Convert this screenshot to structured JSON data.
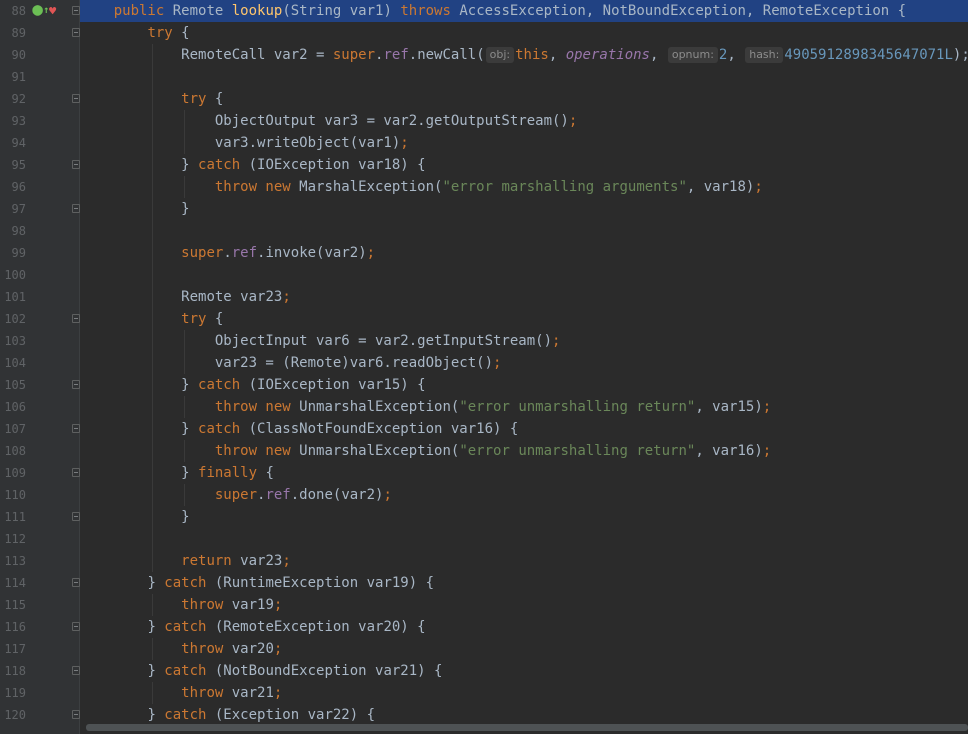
{
  "editor": {
    "lines": [
      {
        "num": "88",
        "hl": true,
        "guides": 0,
        "tokens": [
          {
            "t": "    "
          },
          {
            "t": "public ",
            "c": "kw"
          },
          {
            "t": "Remote "
          },
          {
            "t": "lookup",
            "c": "fn"
          },
          {
            "t": "(String var1) "
          },
          {
            "t": "throws ",
            "c": "kw"
          },
          {
            "t": "AccessException, NotBoundException, RemoteException {"
          }
        ]
      },
      {
        "num": "89",
        "guides": 0,
        "tokens": [
          {
            "t": "        "
          },
          {
            "t": "try ",
            "c": "kw"
          },
          {
            "t": "{"
          }
        ]
      },
      {
        "num": "90",
        "guides": 1,
        "tokens": [
          {
            "t": "            "
          },
          {
            "t": "RemoteCall var2 = "
          },
          {
            "t": "super",
            "c": "kw"
          },
          {
            "t": "."
          },
          {
            "t": "ref",
            "c": "field"
          },
          {
            "t": ".newCall("
          },
          {
            "t": "obj:",
            "c": "hint"
          },
          {
            "t": "this",
            "c": "kw"
          },
          {
            "t": ", "
          },
          {
            "t": "operations",
            "c": "ital"
          },
          {
            "t": ", "
          },
          {
            "t": "opnum:",
            "c": "hint"
          },
          {
            "t": "2",
            "c": "num"
          },
          {
            "t": ", "
          },
          {
            "t": "hash:",
            "c": "hint"
          },
          {
            "t": "4905912898345647071L",
            "c": "num"
          },
          {
            "t": ");"
          }
        ]
      },
      {
        "num": "91",
        "guides": 1,
        "tokens": []
      },
      {
        "num": "92",
        "guides": 1,
        "tokens": [
          {
            "t": "            "
          },
          {
            "t": "try ",
            "c": "kw"
          },
          {
            "t": "{"
          }
        ]
      },
      {
        "num": "93",
        "guides": 2,
        "tokens": [
          {
            "t": "                "
          },
          {
            "t": "ObjectOutput var3 = var2.getOutputStream()"
          },
          {
            "t": ";",
            "c": "kw"
          }
        ]
      },
      {
        "num": "94",
        "guides": 2,
        "tokens": [
          {
            "t": "                "
          },
          {
            "t": "var3.writeObject(var1)"
          },
          {
            "t": ";",
            "c": "kw"
          }
        ]
      },
      {
        "num": "95",
        "guides": 1,
        "tokens": [
          {
            "t": "            "
          },
          {
            "t": "} "
          },
          {
            "t": "catch ",
            "c": "kw"
          },
          {
            "t": "(IOException var18) {"
          }
        ]
      },
      {
        "num": "96",
        "guides": 2,
        "tokens": [
          {
            "t": "                "
          },
          {
            "t": "throw new ",
            "c": "kw"
          },
          {
            "t": "MarshalException("
          },
          {
            "t": "\"error marshalling arguments\"",
            "c": "str"
          },
          {
            "t": ", var18)"
          },
          {
            "t": ";",
            "c": "kw"
          }
        ]
      },
      {
        "num": "97",
        "guides": 1,
        "tokens": [
          {
            "t": "            "
          },
          {
            "t": "}"
          }
        ]
      },
      {
        "num": "98",
        "guides": 1,
        "tokens": []
      },
      {
        "num": "99",
        "guides": 1,
        "tokens": [
          {
            "t": "            "
          },
          {
            "t": "super",
            "c": "kw"
          },
          {
            "t": "."
          },
          {
            "t": "ref",
            "c": "field"
          },
          {
            "t": ".invoke(var2)"
          },
          {
            "t": ";",
            "c": "kw"
          }
        ]
      },
      {
        "num": "100",
        "guides": 1,
        "tokens": []
      },
      {
        "num": "101",
        "guides": 1,
        "tokens": [
          {
            "t": "            "
          },
          {
            "t": "Remote var23"
          },
          {
            "t": ";",
            "c": "kw"
          }
        ]
      },
      {
        "num": "102",
        "guides": 1,
        "tokens": [
          {
            "t": "            "
          },
          {
            "t": "try ",
            "c": "kw"
          },
          {
            "t": "{"
          }
        ]
      },
      {
        "num": "103",
        "guides": 2,
        "tokens": [
          {
            "t": "                "
          },
          {
            "t": "ObjectInput var6 = var2.getInputStream()"
          },
          {
            "t": ";",
            "c": "kw"
          }
        ]
      },
      {
        "num": "104",
        "guides": 2,
        "tokens": [
          {
            "t": "                "
          },
          {
            "t": "var23 = (Remote)var6.readObject()"
          },
          {
            "t": ";",
            "c": "kw"
          }
        ]
      },
      {
        "num": "105",
        "guides": 1,
        "tokens": [
          {
            "t": "            "
          },
          {
            "t": "} "
          },
          {
            "t": "catch ",
            "c": "kw"
          },
          {
            "t": "(IOException var15) {"
          }
        ]
      },
      {
        "num": "106",
        "guides": 2,
        "tokens": [
          {
            "t": "                "
          },
          {
            "t": "throw new ",
            "c": "kw"
          },
          {
            "t": "UnmarshalException("
          },
          {
            "t": "\"error unmarshalling return\"",
            "c": "str"
          },
          {
            "t": ", var15)"
          },
          {
            "t": ";",
            "c": "kw"
          }
        ]
      },
      {
        "num": "107",
        "guides": 1,
        "tokens": [
          {
            "t": "            "
          },
          {
            "t": "} "
          },
          {
            "t": "catch ",
            "c": "kw"
          },
          {
            "t": "(ClassNotFoundException var16) {"
          }
        ]
      },
      {
        "num": "108",
        "guides": 2,
        "tokens": [
          {
            "t": "                "
          },
          {
            "t": "throw new ",
            "c": "kw"
          },
          {
            "t": "UnmarshalException("
          },
          {
            "t": "\"error unmarshalling return\"",
            "c": "str"
          },
          {
            "t": ", var16)"
          },
          {
            "t": ";",
            "c": "kw"
          }
        ]
      },
      {
        "num": "109",
        "guides": 1,
        "tokens": [
          {
            "t": "            "
          },
          {
            "t": "} "
          },
          {
            "t": "finally ",
            "c": "kw"
          },
          {
            "t": "{"
          }
        ]
      },
      {
        "num": "110",
        "guides": 2,
        "tokens": [
          {
            "t": "                "
          },
          {
            "t": "super",
            "c": "kw"
          },
          {
            "t": "."
          },
          {
            "t": "ref",
            "c": "field"
          },
          {
            "t": ".done(var2)"
          },
          {
            "t": ";",
            "c": "kw"
          }
        ]
      },
      {
        "num": "111",
        "guides": 1,
        "tokens": [
          {
            "t": "            "
          },
          {
            "t": "}"
          }
        ]
      },
      {
        "num": "112",
        "guides": 1,
        "tokens": []
      },
      {
        "num": "113",
        "guides": 1,
        "tokens": [
          {
            "t": "            "
          },
          {
            "t": "return ",
            "c": "kw"
          },
          {
            "t": "var23"
          },
          {
            "t": ";",
            "c": "kw"
          }
        ]
      },
      {
        "num": "114",
        "guides": 0,
        "tokens": [
          {
            "t": "        "
          },
          {
            "t": "} "
          },
          {
            "t": "catch ",
            "c": "kw"
          },
          {
            "t": "(RuntimeException var19) {"
          }
        ]
      },
      {
        "num": "115",
        "guides": 1,
        "tokens": [
          {
            "t": "            "
          },
          {
            "t": "throw ",
            "c": "kw"
          },
          {
            "t": "var19"
          },
          {
            "t": ";",
            "c": "kw"
          }
        ]
      },
      {
        "num": "116",
        "guides": 0,
        "tokens": [
          {
            "t": "        "
          },
          {
            "t": "} "
          },
          {
            "t": "catch ",
            "c": "kw"
          },
          {
            "t": "(RemoteException var20) {"
          }
        ]
      },
      {
        "num": "117",
        "guides": 1,
        "tokens": [
          {
            "t": "            "
          },
          {
            "t": "throw ",
            "c": "kw"
          },
          {
            "t": "var20"
          },
          {
            "t": ";",
            "c": "kw"
          }
        ]
      },
      {
        "num": "118",
        "guides": 0,
        "tokens": [
          {
            "t": "        "
          },
          {
            "t": "} "
          },
          {
            "t": "catch ",
            "c": "kw"
          },
          {
            "t": "(NotBoundException var21) {"
          }
        ]
      },
      {
        "num": "119",
        "guides": 1,
        "tokens": [
          {
            "t": "            "
          },
          {
            "t": "throw ",
            "c": "kw"
          },
          {
            "t": "var21"
          },
          {
            "t": ";",
            "c": "kw"
          }
        ]
      },
      {
        "num": "120",
        "guides": 0,
        "tokens": [
          {
            "t": "        "
          },
          {
            "t": "} "
          },
          {
            "t": "catch ",
            "c": "kw"
          },
          {
            "t": "(Exception var22) {"
          }
        ]
      }
    ],
    "fold_lines": [
      "88",
      "89",
      "92",
      "95",
      "97",
      "102",
      "105",
      "107",
      "109",
      "111",
      "114",
      "116",
      "118",
      "120"
    ],
    "gutter_icons": {
      "implements": "implements-icon",
      "breakpoint": "breakpoint-icon"
    }
  }
}
